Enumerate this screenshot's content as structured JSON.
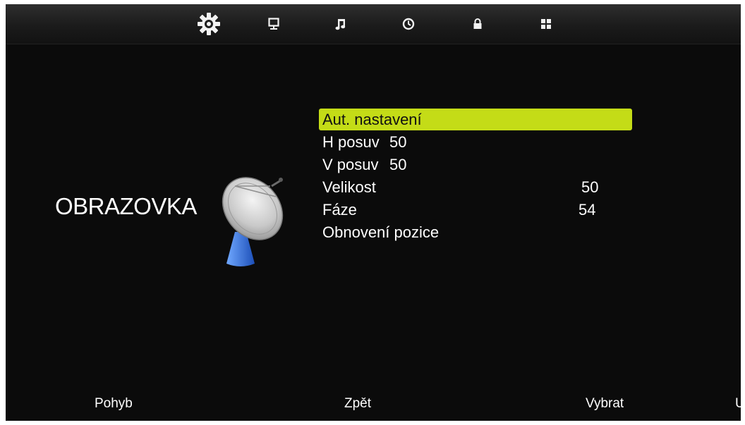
{
  "tabs": [
    {
      "icon": "gear-icon"
    },
    {
      "icon": "monitor-icon"
    },
    {
      "icon": "music-note-icon"
    },
    {
      "icon": "clock-icon"
    },
    {
      "icon": "lock-icon"
    },
    {
      "icon": "grid-icon"
    }
  ],
  "active_tab_index": 0,
  "page": {
    "title": "OBRAZOVKA",
    "icon": "satellite-dish-icon"
  },
  "menu": {
    "selected_index": 0,
    "items": [
      {
        "label": "Aut. nastavení",
        "value": null
      },
      {
        "label": "H posuv",
        "value": "50"
      },
      {
        "label": "V posuv",
        "value": "50"
      },
      {
        "label": "Velikost",
        "value": "50"
      },
      {
        "label": "Fáze",
        "value": "54"
      },
      {
        "label": "Obnovení pozice",
        "value": null
      }
    ]
  },
  "footer": {
    "move": "Pohyb",
    "back": "Zpět",
    "select": "Vybrat",
    "cut": "U"
  },
  "colors": {
    "highlight": "#c4dc17",
    "background": "#0b0b0b",
    "text": "#ffffff"
  }
}
